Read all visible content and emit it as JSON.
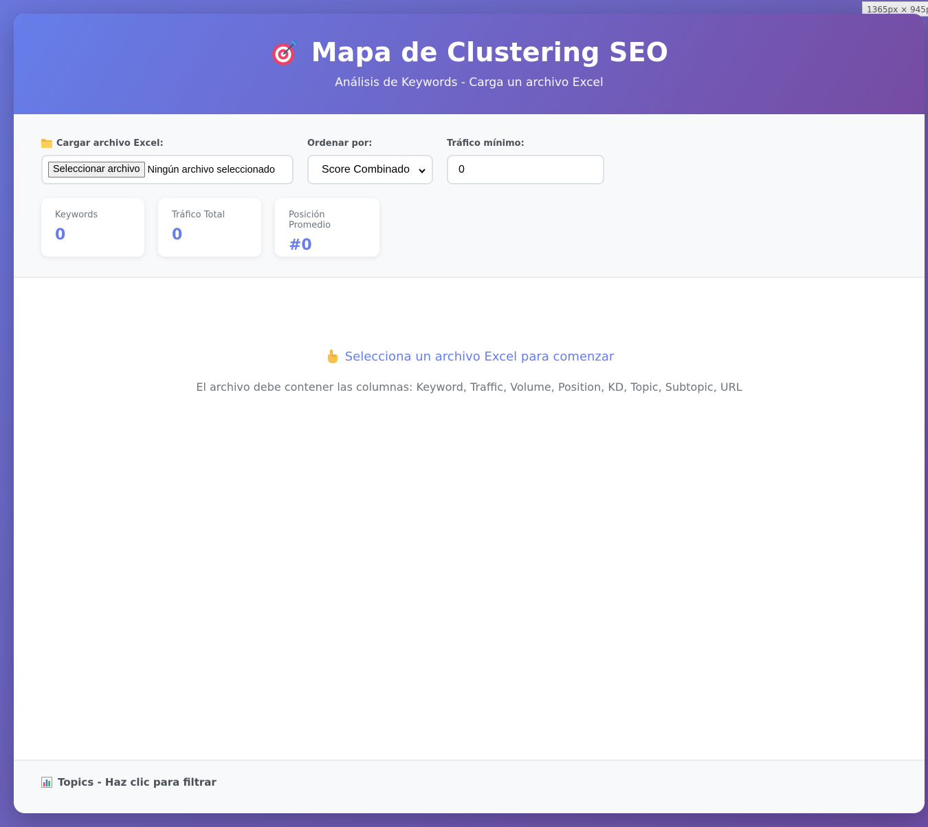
{
  "viewport_badge": "1365px × 945px",
  "header": {
    "icon": "target-icon",
    "title": "Mapa de Clustering SEO",
    "subtitle": "Análisis de Keywords - Carga un archivo Excel"
  },
  "controls": {
    "file": {
      "label": "Cargar archivo Excel:",
      "icon": "folder-icon",
      "button_label": "Seleccionar archivo",
      "status": "Ningún archivo seleccionado"
    },
    "sort": {
      "label": "Ordenar por:",
      "selected": "Score Combinado"
    },
    "min_traffic": {
      "label": "Tráfico mínimo:",
      "value": "0"
    }
  },
  "stats": [
    {
      "label": "Keywords",
      "value": "0"
    },
    {
      "label": "Tráfico Total",
      "value": "0"
    },
    {
      "label": "Posición Promedio",
      "value": "#0"
    }
  ],
  "empty_state": {
    "icon": "pointing-hand-icon",
    "title": "Selecciona un archivo Excel para comenzar",
    "description": "El archivo debe contener las columnas: Keyword, Traffic, Volume, Position, KD, Topic, Subtopic, URL"
  },
  "footer": {
    "icon": "bar-chart-icon",
    "title": "Topics - Haz clic para filtrar"
  },
  "colors": {
    "accent": "#667eea",
    "gradient_end": "#764ba2"
  }
}
